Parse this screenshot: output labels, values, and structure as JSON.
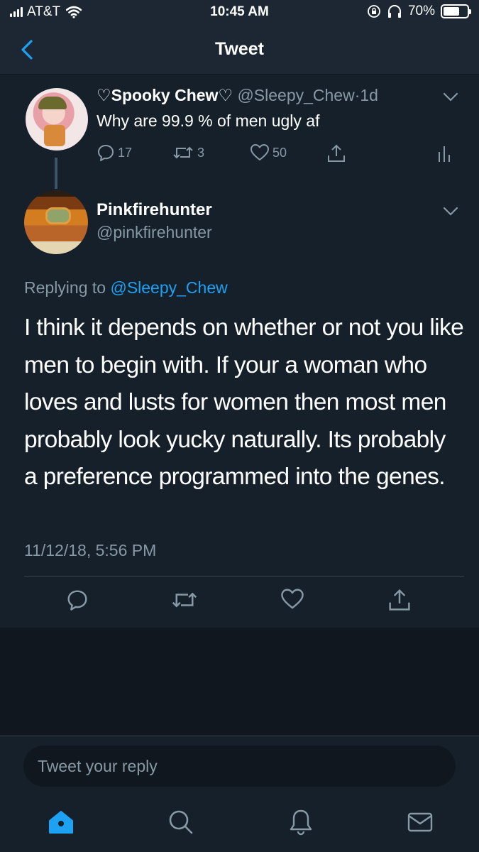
{
  "status_bar": {
    "carrier": "AT&T",
    "time": "10:45 AM",
    "battery": "70%",
    "battery_level": 0.7,
    "icons": [
      "signal-icon",
      "wifi-icon",
      "rotation-lock-icon",
      "headphones-icon",
      "battery-icon"
    ]
  },
  "header": {
    "title": "Tweet",
    "back_icon": "chevron-left-icon"
  },
  "original_tweet": {
    "name": "♡Spooky Chew♡",
    "handle": "@Sleepy_Chew",
    "separator": "·",
    "age": "1d",
    "text": "Why are 99.9 % of men ugly af",
    "replies": "17",
    "retweets": "3",
    "likes": "50"
  },
  "reply_tweet": {
    "name": "Pinkfirehunter",
    "handle": "@pinkfirehunter",
    "replying_prefix": "Replying to",
    "replying_to": "@Sleepy_Chew",
    "text": "I think it depends on whether or not you like men to begin with. If your a woman who loves and lusts for women then most men probably look yucky naturally. Its probably a preference programmed into the genes.",
    "timestamp": "11/12/18, 5:56 PM"
  },
  "compose": {
    "placeholder": "Tweet your reply"
  },
  "tabs": [
    "home-icon",
    "search-icon",
    "notifications-icon",
    "messages-icon"
  ],
  "colors": {
    "background": "#15202b",
    "bar_background": "#1c2733",
    "accent": "#1da1f2",
    "secondary_text": "#8899a6",
    "divider": "#38444d"
  }
}
